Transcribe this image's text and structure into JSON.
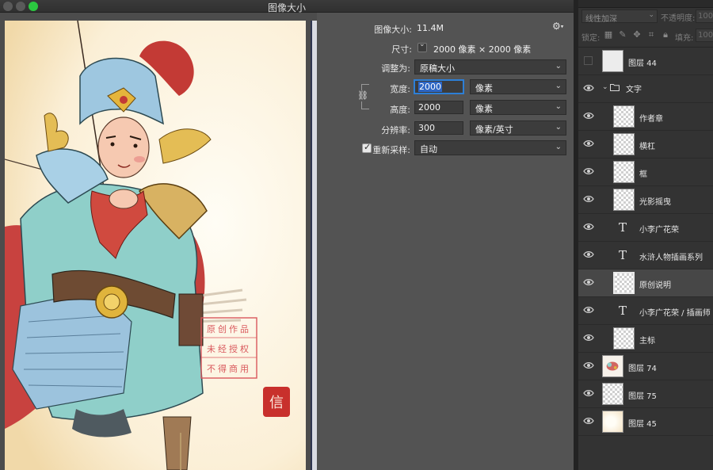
{
  "window": {
    "title": "图像大小",
    "traffic_lights": [
      "close",
      "minimize",
      "zoom"
    ],
    "zoom_color": "#2bc840"
  },
  "dialog": {
    "image_size_label": "图像大小:",
    "image_size_value": "11.4M",
    "gear_icon": "gear-icon",
    "dimensions_label": "尺寸:",
    "dimensions_value": "2000 像素  ×  2000 像素",
    "fit_to_label": "调整为:",
    "fit_to_value": "原稿大小",
    "width_label": "宽度:",
    "width_value": "2000",
    "width_unit": "像素",
    "height_label": "高度:",
    "height_value": "2000",
    "height_unit": "像素",
    "resolution_label": "分辨率:",
    "resolution_value": "300",
    "resolution_unit": "像素/英寸",
    "resample_label": "重新采样:",
    "resample_checked": true,
    "resample_value": "自动",
    "constrain_icon": "chain-link-icon",
    "accent_color": "#2d7fd6"
  },
  "preview": {
    "stamp_lines": [
      "原创作品",
      "未经授权",
      "不得商用"
    ],
    "seal_char": "信"
  },
  "layers_panel": {
    "blend_mode": "线性加深",
    "opacity_label": "不透明度:",
    "opacity_value": "100",
    "lock_label": "锁定:",
    "fill_label": "填充:",
    "fill_value": "100",
    "layers": [
      {
        "name": "图层 44",
        "type": "pixel",
        "visible": false,
        "thumb": "plain",
        "selected": false
      },
      {
        "name": "文字",
        "type": "group",
        "visible": true,
        "thumb": "",
        "selected": false
      },
      {
        "name": "作者章",
        "type": "pixel",
        "visible": true,
        "thumb": "checker",
        "selected": false
      },
      {
        "name": "横杠",
        "type": "pixel",
        "visible": true,
        "thumb": "checker",
        "selected": false
      },
      {
        "name": "框",
        "type": "pixel",
        "visible": true,
        "thumb": "checker",
        "selected": false
      },
      {
        "name": "光影摇曳",
        "type": "pixel",
        "visible": true,
        "thumb": "checker",
        "selected": false
      },
      {
        "name": "小李广花荣",
        "type": "text",
        "visible": true,
        "thumb": "",
        "selected": false
      },
      {
        "name": "水浒人物插画系列",
        "type": "text",
        "visible": true,
        "thumb": "",
        "selected": false
      },
      {
        "name": "原创说明",
        "type": "pixel",
        "visible": true,
        "thumb": "checker",
        "selected": true
      },
      {
        "name": "小李广花荣 / 插画师",
        "type": "text",
        "visible": true,
        "thumb": "",
        "selected": false
      },
      {
        "name": "主标",
        "type": "pixel",
        "visible": true,
        "thumb": "checker",
        "selected": false
      },
      {
        "name": "图层 74",
        "type": "pixel",
        "visible": true,
        "thumb": "art",
        "selected": false
      },
      {
        "name": "图层 75",
        "type": "pixel",
        "visible": true,
        "thumb": "checker",
        "selected": false
      },
      {
        "name": "图层 45",
        "type": "pixel",
        "visible": true,
        "thumb": "cream",
        "selected": false
      }
    ]
  }
}
